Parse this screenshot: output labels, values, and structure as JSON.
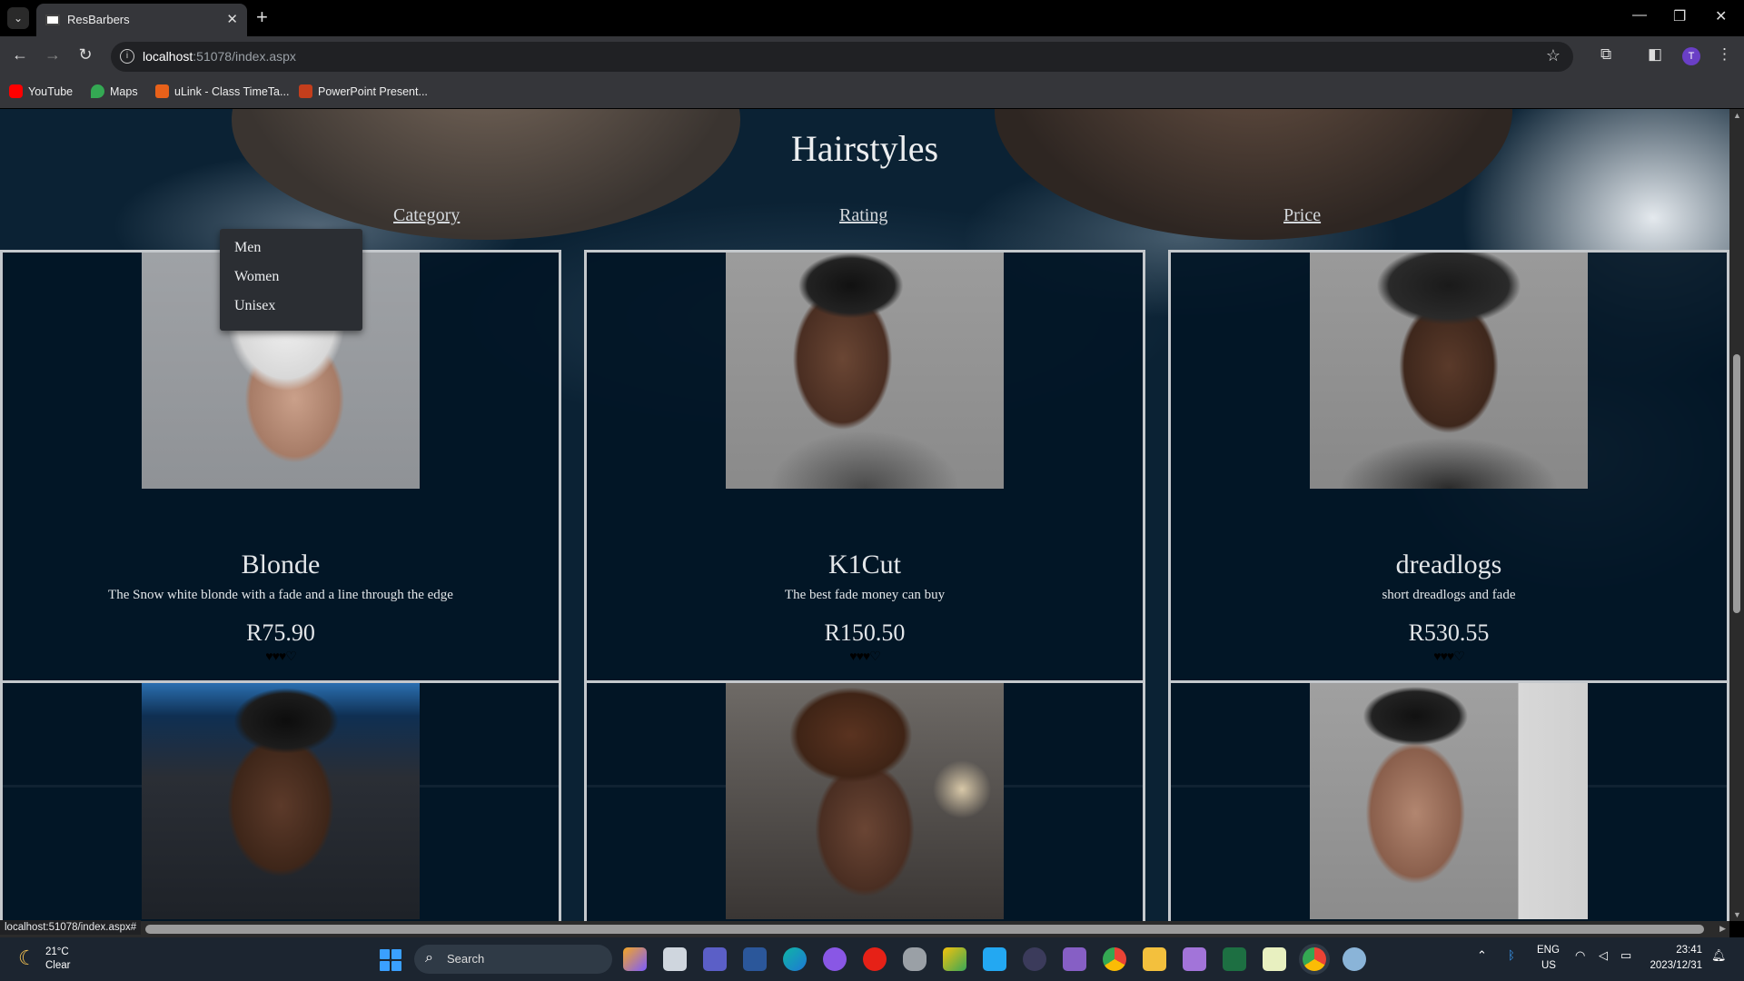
{
  "browser": {
    "tab_title": "ResBarbers",
    "url_host": "localhost",
    "url_rest": ":51078/index.aspx",
    "profile_initial": "T",
    "bookmarks": [
      {
        "label": "YouTube",
        "color": "#ff0000"
      },
      {
        "label": "Maps",
        "color": "#34a853"
      },
      {
        "label": "uLink - Class TimeTa...",
        "color": "#e8611a"
      },
      {
        "label": "PowerPoint Present...",
        "color": "#c43e1c"
      }
    ]
  },
  "page": {
    "title": "Hairstyles",
    "filters": {
      "category": "Category",
      "rating": "Rating",
      "price": "Price"
    },
    "category_menu": [
      "Men",
      "Women",
      "Unisex"
    ],
    "cards": [
      {
        "name": "Blonde",
        "description": "The Snow white blonde with a fade and a line through the edge",
        "price": "R75.90",
        "rating": 3.5
      },
      {
        "name": "K1Cut",
        "description": "The best fade money can buy",
        "price": "R150.50",
        "rating": 3.5
      },
      {
        "name": "dreadlogs",
        "description": "short dreadlogs and fade",
        "price": "R530.55",
        "rating": 3.5
      }
    ],
    "status_url": "localhost:51078/index.aspx#"
  },
  "taskbar": {
    "weather_temp": "21°C",
    "weather_condition": "Clear",
    "search_label": "Search",
    "language": "ENG",
    "region": "US",
    "time": "23:41",
    "date": "2023/12/31"
  }
}
